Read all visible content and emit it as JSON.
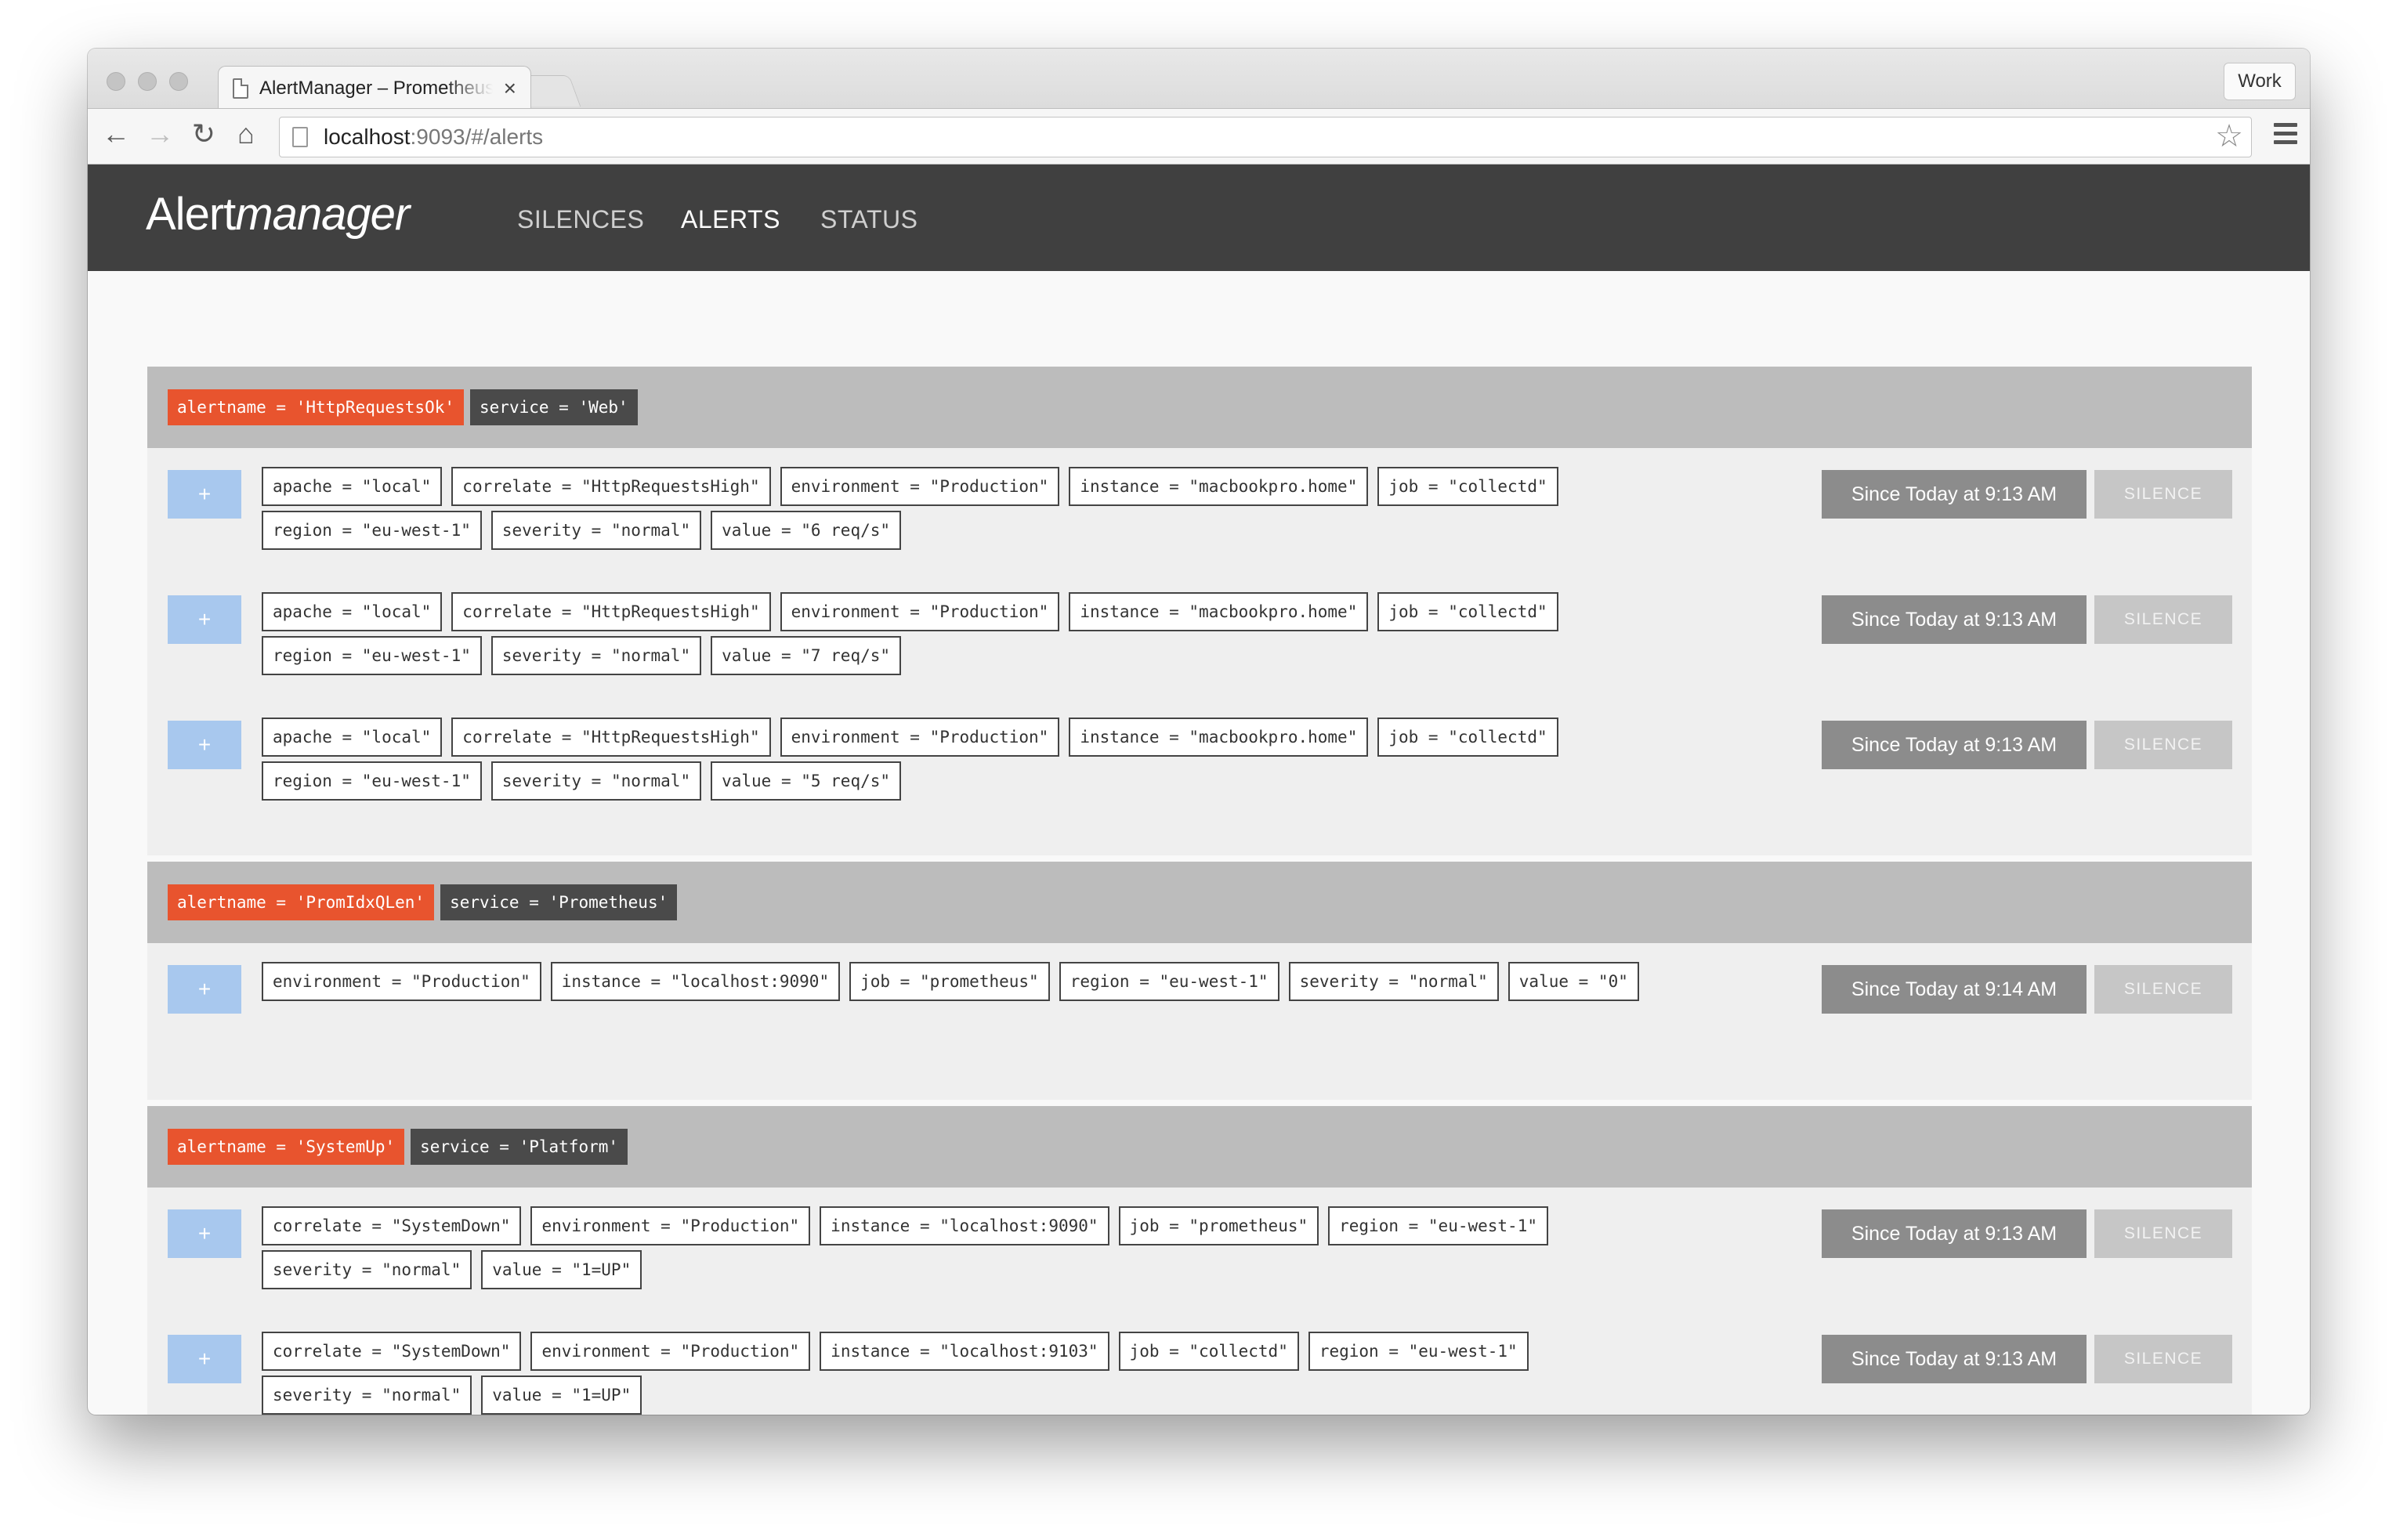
{
  "browser": {
    "tab_title": "AlertManager – Prometheus",
    "tab_close": "×",
    "profile_button": "Work",
    "url_host": "localhost",
    "url_rest": ":9093/#/alerts",
    "icons": {
      "back": "←",
      "forward": "→",
      "reload": "↻",
      "home": "⌂",
      "star": "☆"
    }
  },
  "navbar": {
    "brand_plain": "Alert",
    "brand_italic": "manager",
    "links": [
      "SILENCES",
      "ALERTS",
      "STATUS"
    ],
    "active_link": "ALERTS"
  },
  "groups": [
    {
      "alertname": "alertname = 'HttpRequestsOk'",
      "service": "service = 'Web'",
      "alerts": [
        {
          "expand": "+",
          "labels": [
            "apache = \"local\"",
            "correlate = \"HttpRequestsHigh\"",
            "environment = \"Production\"",
            "instance = \"macbookpro.home\"",
            "job = \"collectd\"",
            "region = \"eu-west-1\"",
            "severity = \"normal\"",
            "value = \"6 req/s\""
          ],
          "since": "Since Today at 9:13 AM",
          "silence": "SILENCE"
        },
        {
          "expand": "+",
          "labels": [
            "apache = \"local\"",
            "correlate = \"HttpRequestsHigh\"",
            "environment = \"Production\"",
            "instance = \"macbookpro.home\"",
            "job = \"collectd\"",
            "region = \"eu-west-1\"",
            "severity = \"normal\"",
            "value = \"7 req/s\""
          ],
          "since": "Since Today at 9:13 AM",
          "silence": "SILENCE"
        },
        {
          "expand": "+",
          "labels": [
            "apache = \"local\"",
            "correlate = \"HttpRequestsHigh\"",
            "environment = \"Production\"",
            "instance = \"macbookpro.home\"",
            "job = \"collectd\"",
            "region = \"eu-west-1\"",
            "severity = \"normal\"",
            "value = \"5 req/s\""
          ],
          "since": "Since Today at 9:13 AM",
          "silence": "SILENCE"
        }
      ]
    },
    {
      "alertname": "alertname = 'PromIdxQLen'",
      "service": "service = 'Prometheus'",
      "alerts": [
        {
          "expand": "+",
          "labels": [
            "environment = \"Production\"",
            "instance = \"localhost:9090\"",
            "job = \"prometheus\"",
            "region = \"eu-west-1\"",
            "severity = \"normal\"",
            "value = \"0\""
          ],
          "since": "Since Today at 9:14 AM",
          "silence": "SILENCE"
        }
      ]
    },
    {
      "alertname": "alertname = 'SystemUp'",
      "service": "service = 'Platform'",
      "alerts": [
        {
          "expand": "+",
          "labels": [
            "correlate = \"SystemDown\"",
            "environment = \"Production\"",
            "instance = \"localhost:9090\"",
            "job = \"prometheus\"",
            "region = \"eu-west-1\"",
            "severity = \"normal\"",
            "value = \"1=UP\""
          ],
          "since": "Since Today at 9:13 AM",
          "silence": "SILENCE"
        },
        {
          "expand": "+",
          "labels": [
            "correlate = \"SystemDown\"",
            "environment = \"Production\"",
            "instance = \"localhost:9103\"",
            "job = \"collectd\"",
            "region = \"eu-west-1\"",
            "severity = \"normal\"",
            "value = \"1=UP\""
          ],
          "since": "Since Today at 9:13 AM",
          "silence": "SILENCE"
        }
      ]
    }
  ],
  "colors": {
    "alertname_tag": "#e8542e",
    "service_tag": "#4a4a4a",
    "expand_button": "#a8c8ee",
    "since_button": "#8c8c8c",
    "silence_button": "#c6c6c6",
    "navbar": "#404040"
  }
}
